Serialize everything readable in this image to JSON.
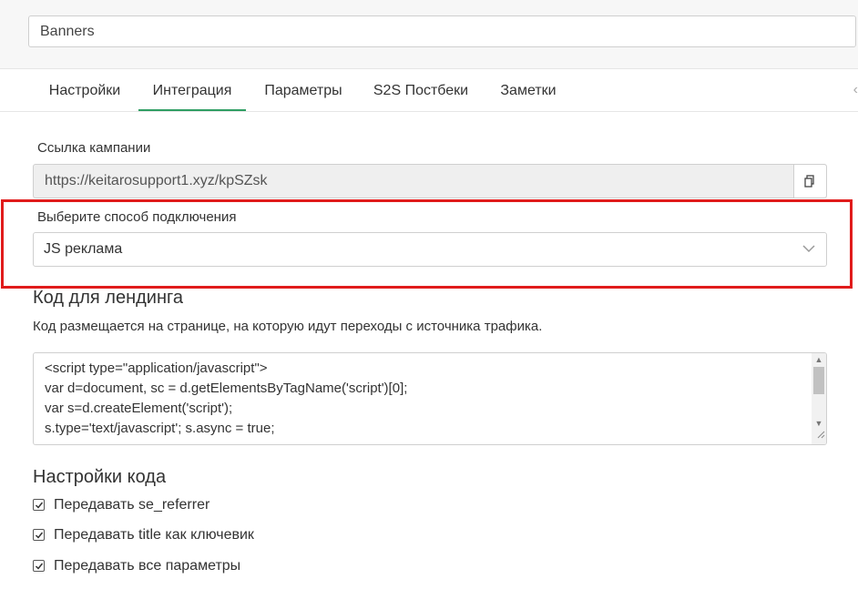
{
  "campaign": {
    "name": "Banners"
  },
  "tabs": [
    {
      "label": "Настройки"
    },
    {
      "label": "Интеграция"
    },
    {
      "label": "Параметры"
    },
    {
      "label": "S2S Постбеки"
    },
    {
      "label": "Заметки"
    }
  ],
  "active_tab": "Интеграция",
  "campaign_link": {
    "label": "Ссылка кампании",
    "value": "https://keitarosupport1.xyz/kpSZsk"
  },
  "connection": {
    "label": "Выберите способ подключения",
    "selected": "JS реклама"
  },
  "landing_code": {
    "title": "Код для лендинга",
    "description": "Код размещается на странице, на которую идут переходы с источника трафика.",
    "lines": [
      "<script type=\"application/javascript\">",
      "var d=document, sc = d.getElementsByTagName('script')[0];",
      "var s=d.createElement('script');",
      "s.type='text/javascript'; s.async = true;"
    ]
  },
  "code_settings": {
    "title": "Настройки кода",
    "options": [
      {
        "label": "Передавать se_referrer",
        "checked": true
      },
      {
        "label": "Передавать title как ключевик",
        "checked": true
      },
      {
        "label": "Передавать все параметры",
        "checked": true
      }
    ]
  },
  "colors": {
    "accent": "#2f9e63",
    "highlight": "#e01b1b"
  },
  "icons": {
    "copy": "copy-icon",
    "select_caret": "chevron-down-icon",
    "tabs_scroll": "chevron-left-icon"
  }
}
